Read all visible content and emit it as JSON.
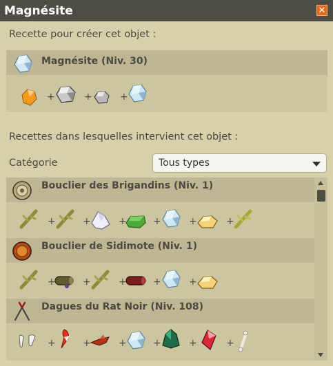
{
  "window": {
    "title": "Magnésite",
    "close_icon": "close-icon",
    "close_glyph": "✕"
  },
  "craft_section": {
    "label": "Recette pour créer cet objet :",
    "item": {
      "name": "Magnésite (Niv. 30)",
      "icon": "magnesite-crystal-icon"
    },
    "ingredients": [
      "amber-gem-icon",
      "grey-stone-icon",
      "small-grey-stone-icon",
      "magnesite-crystal-icon"
    ]
  },
  "usage_section": {
    "label": "Recettes dans lesquelles intervient cet objet :",
    "category_label": "Catégorie",
    "category_selected": "Tous types",
    "recipes": [
      {
        "name": "Bouclier des Brigandins (Niv. 1)",
        "icon": "round-shield-icon",
        "ingredients": [
          "branch-icon",
          "branch-icon",
          "white-crystal-icon",
          "green-leaf-icon",
          "magnesite-crystal-icon",
          "yellow-nugget-icon",
          "branch-icon"
        ]
      },
      {
        "name": "Bouclier de Sidimote (Niv. 1)",
        "icon": "wooden-shield-icon",
        "ingredients": [
          "branch-icon",
          "mossy-log-icon",
          "branch-icon",
          "red-log-icon",
          "magnesite-crystal-icon",
          "yellow-nugget-icon"
        ]
      },
      {
        "name": "Dagues du Rat Noir (Niv. 108)",
        "icon": "daggers-icon",
        "ingredients": [
          "white-teeth-icon",
          "red-feather-icon",
          "red-claw-icon",
          "magnesite-crystal-icon",
          "green-crystal-icon",
          "red-gem-icon",
          "bone-icon"
        ]
      }
    ]
  },
  "colors": {
    "background": "#d6d0ab",
    "titlebar": "#4d4d44",
    "accent_close": "#e76a1c",
    "band": "#bfb793"
  }
}
